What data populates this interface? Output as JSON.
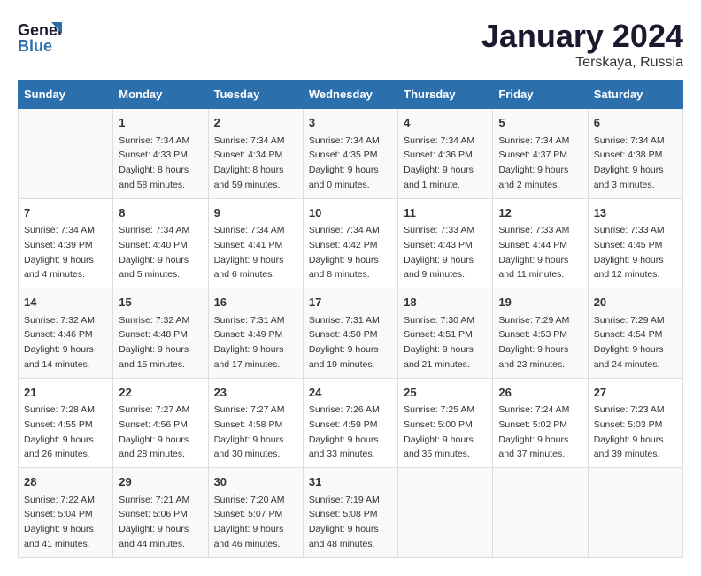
{
  "logo": {
    "line1": "General",
    "line2": "Blue"
  },
  "title": "January 2024",
  "subtitle": "Terskaya, Russia",
  "days_of_week": [
    "Sunday",
    "Monday",
    "Tuesday",
    "Wednesday",
    "Thursday",
    "Friday",
    "Saturday"
  ],
  "weeks": [
    [
      {
        "day": "",
        "details": ""
      },
      {
        "day": "1",
        "details": "Sunrise: 7:34 AM\nSunset: 4:33 PM\nDaylight: 8 hours\nand 58 minutes."
      },
      {
        "day": "2",
        "details": "Sunrise: 7:34 AM\nSunset: 4:34 PM\nDaylight: 8 hours\nand 59 minutes."
      },
      {
        "day": "3",
        "details": "Sunrise: 7:34 AM\nSunset: 4:35 PM\nDaylight: 9 hours\nand 0 minutes."
      },
      {
        "day": "4",
        "details": "Sunrise: 7:34 AM\nSunset: 4:36 PM\nDaylight: 9 hours\nand 1 minute."
      },
      {
        "day": "5",
        "details": "Sunrise: 7:34 AM\nSunset: 4:37 PM\nDaylight: 9 hours\nand 2 minutes."
      },
      {
        "day": "6",
        "details": "Sunrise: 7:34 AM\nSunset: 4:38 PM\nDaylight: 9 hours\nand 3 minutes."
      }
    ],
    [
      {
        "day": "7",
        "details": "Sunrise: 7:34 AM\nSunset: 4:39 PM\nDaylight: 9 hours\nand 4 minutes."
      },
      {
        "day": "8",
        "details": "Sunrise: 7:34 AM\nSunset: 4:40 PM\nDaylight: 9 hours\nand 5 minutes."
      },
      {
        "day": "9",
        "details": "Sunrise: 7:34 AM\nSunset: 4:41 PM\nDaylight: 9 hours\nand 6 minutes."
      },
      {
        "day": "10",
        "details": "Sunrise: 7:34 AM\nSunset: 4:42 PM\nDaylight: 9 hours\nand 8 minutes."
      },
      {
        "day": "11",
        "details": "Sunrise: 7:33 AM\nSunset: 4:43 PM\nDaylight: 9 hours\nand 9 minutes."
      },
      {
        "day": "12",
        "details": "Sunrise: 7:33 AM\nSunset: 4:44 PM\nDaylight: 9 hours\nand 11 minutes."
      },
      {
        "day": "13",
        "details": "Sunrise: 7:33 AM\nSunset: 4:45 PM\nDaylight: 9 hours\nand 12 minutes."
      }
    ],
    [
      {
        "day": "14",
        "details": "Sunrise: 7:32 AM\nSunset: 4:46 PM\nDaylight: 9 hours\nand 14 minutes."
      },
      {
        "day": "15",
        "details": "Sunrise: 7:32 AM\nSunset: 4:48 PM\nDaylight: 9 hours\nand 15 minutes."
      },
      {
        "day": "16",
        "details": "Sunrise: 7:31 AM\nSunset: 4:49 PM\nDaylight: 9 hours\nand 17 minutes."
      },
      {
        "day": "17",
        "details": "Sunrise: 7:31 AM\nSunset: 4:50 PM\nDaylight: 9 hours\nand 19 minutes."
      },
      {
        "day": "18",
        "details": "Sunrise: 7:30 AM\nSunset: 4:51 PM\nDaylight: 9 hours\nand 21 minutes."
      },
      {
        "day": "19",
        "details": "Sunrise: 7:29 AM\nSunset: 4:53 PM\nDaylight: 9 hours\nand 23 minutes."
      },
      {
        "day": "20",
        "details": "Sunrise: 7:29 AM\nSunset: 4:54 PM\nDaylight: 9 hours\nand 24 minutes."
      }
    ],
    [
      {
        "day": "21",
        "details": "Sunrise: 7:28 AM\nSunset: 4:55 PM\nDaylight: 9 hours\nand 26 minutes."
      },
      {
        "day": "22",
        "details": "Sunrise: 7:27 AM\nSunset: 4:56 PM\nDaylight: 9 hours\nand 28 minutes."
      },
      {
        "day": "23",
        "details": "Sunrise: 7:27 AM\nSunset: 4:58 PM\nDaylight: 9 hours\nand 30 minutes."
      },
      {
        "day": "24",
        "details": "Sunrise: 7:26 AM\nSunset: 4:59 PM\nDaylight: 9 hours\nand 33 minutes."
      },
      {
        "day": "25",
        "details": "Sunrise: 7:25 AM\nSunset: 5:00 PM\nDaylight: 9 hours\nand 35 minutes."
      },
      {
        "day": "26",
        "details": "Sunrise: 7:24 AM\nSunset: 5:02 PM\nDaylight: 9 hours\nand 37 minutes."
      },
      {
        "day": "27",
        "details": "Sunrise: 7:23 AM\nSunset: 5:03 PM\nDaylight: 9 hours\nand 39 minutes."
      }
    ],
    [
      {
        "day": "28",
        "details": "Sunrise: 7:22 AM\nSunset: 5:04 PM\nDaylight: 9 hours\nand 41 minutes."
      },
      {
        "day": "29",
        "details": "Sunrise: 7:21 AM\nSunset: 5:06 PM\nDaylight: 9 hours\nand 44 minutes."
      },
      {
        "day": "30",
        "details": "Sunrise: 7:20 AM\nSunset: 5:07 PM\nDaylight: 9 hours\nand 46 minutes."
      },
      {
        "day": "31",
        "details": "Sunrise: 7:19 AM\nSunset: 5:08 PM\nDaylight: 9 hours\nand 48 minutes."
      },
      {
        "day": "",
        "details": ""
      },
      {
        "day": "",
        "details": ""
      },
      {
        "day": "",
        "details": ""
      }
    ]
  ]
}
